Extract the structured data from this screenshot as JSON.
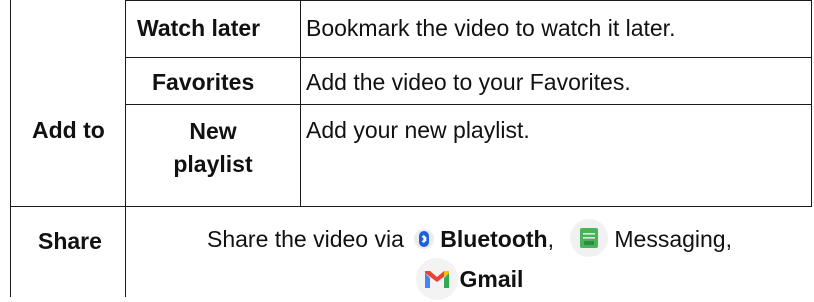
{
  "table": {
    "group_add_to": "Add to",
    "group_share": "Share",
    "rows": [
      {
        "option": "Watch later",
        "description": "Bookmark the video to watch it later."
      },
      {
        "option": "Favorites",
        "description": "Add the video to your Favorites."
      },
      {
        "option_line1": "New",
        "option_line2": "playlist",
        "description": "Add your new playlist."
      }
    ],
    "share": {
      "prefix": "Share the video via",
      "bluetooth": "Bluetooth",
      "comma1": ",",
      "messaging": "Messaging,",
      "gmail": "Gmail"
    }
  },
  "icons": {
    "bluetooth": "bluetooth-icon",
    "messaging": "messaging-icon",
    "gmail": "gmail-icon"
  },
  "colors": {
    "bluetooth_blue": "#1d5fd6",
    "messaging_green": "#49b35a",
    "gmail_red": "#ea4335"
  }
}
